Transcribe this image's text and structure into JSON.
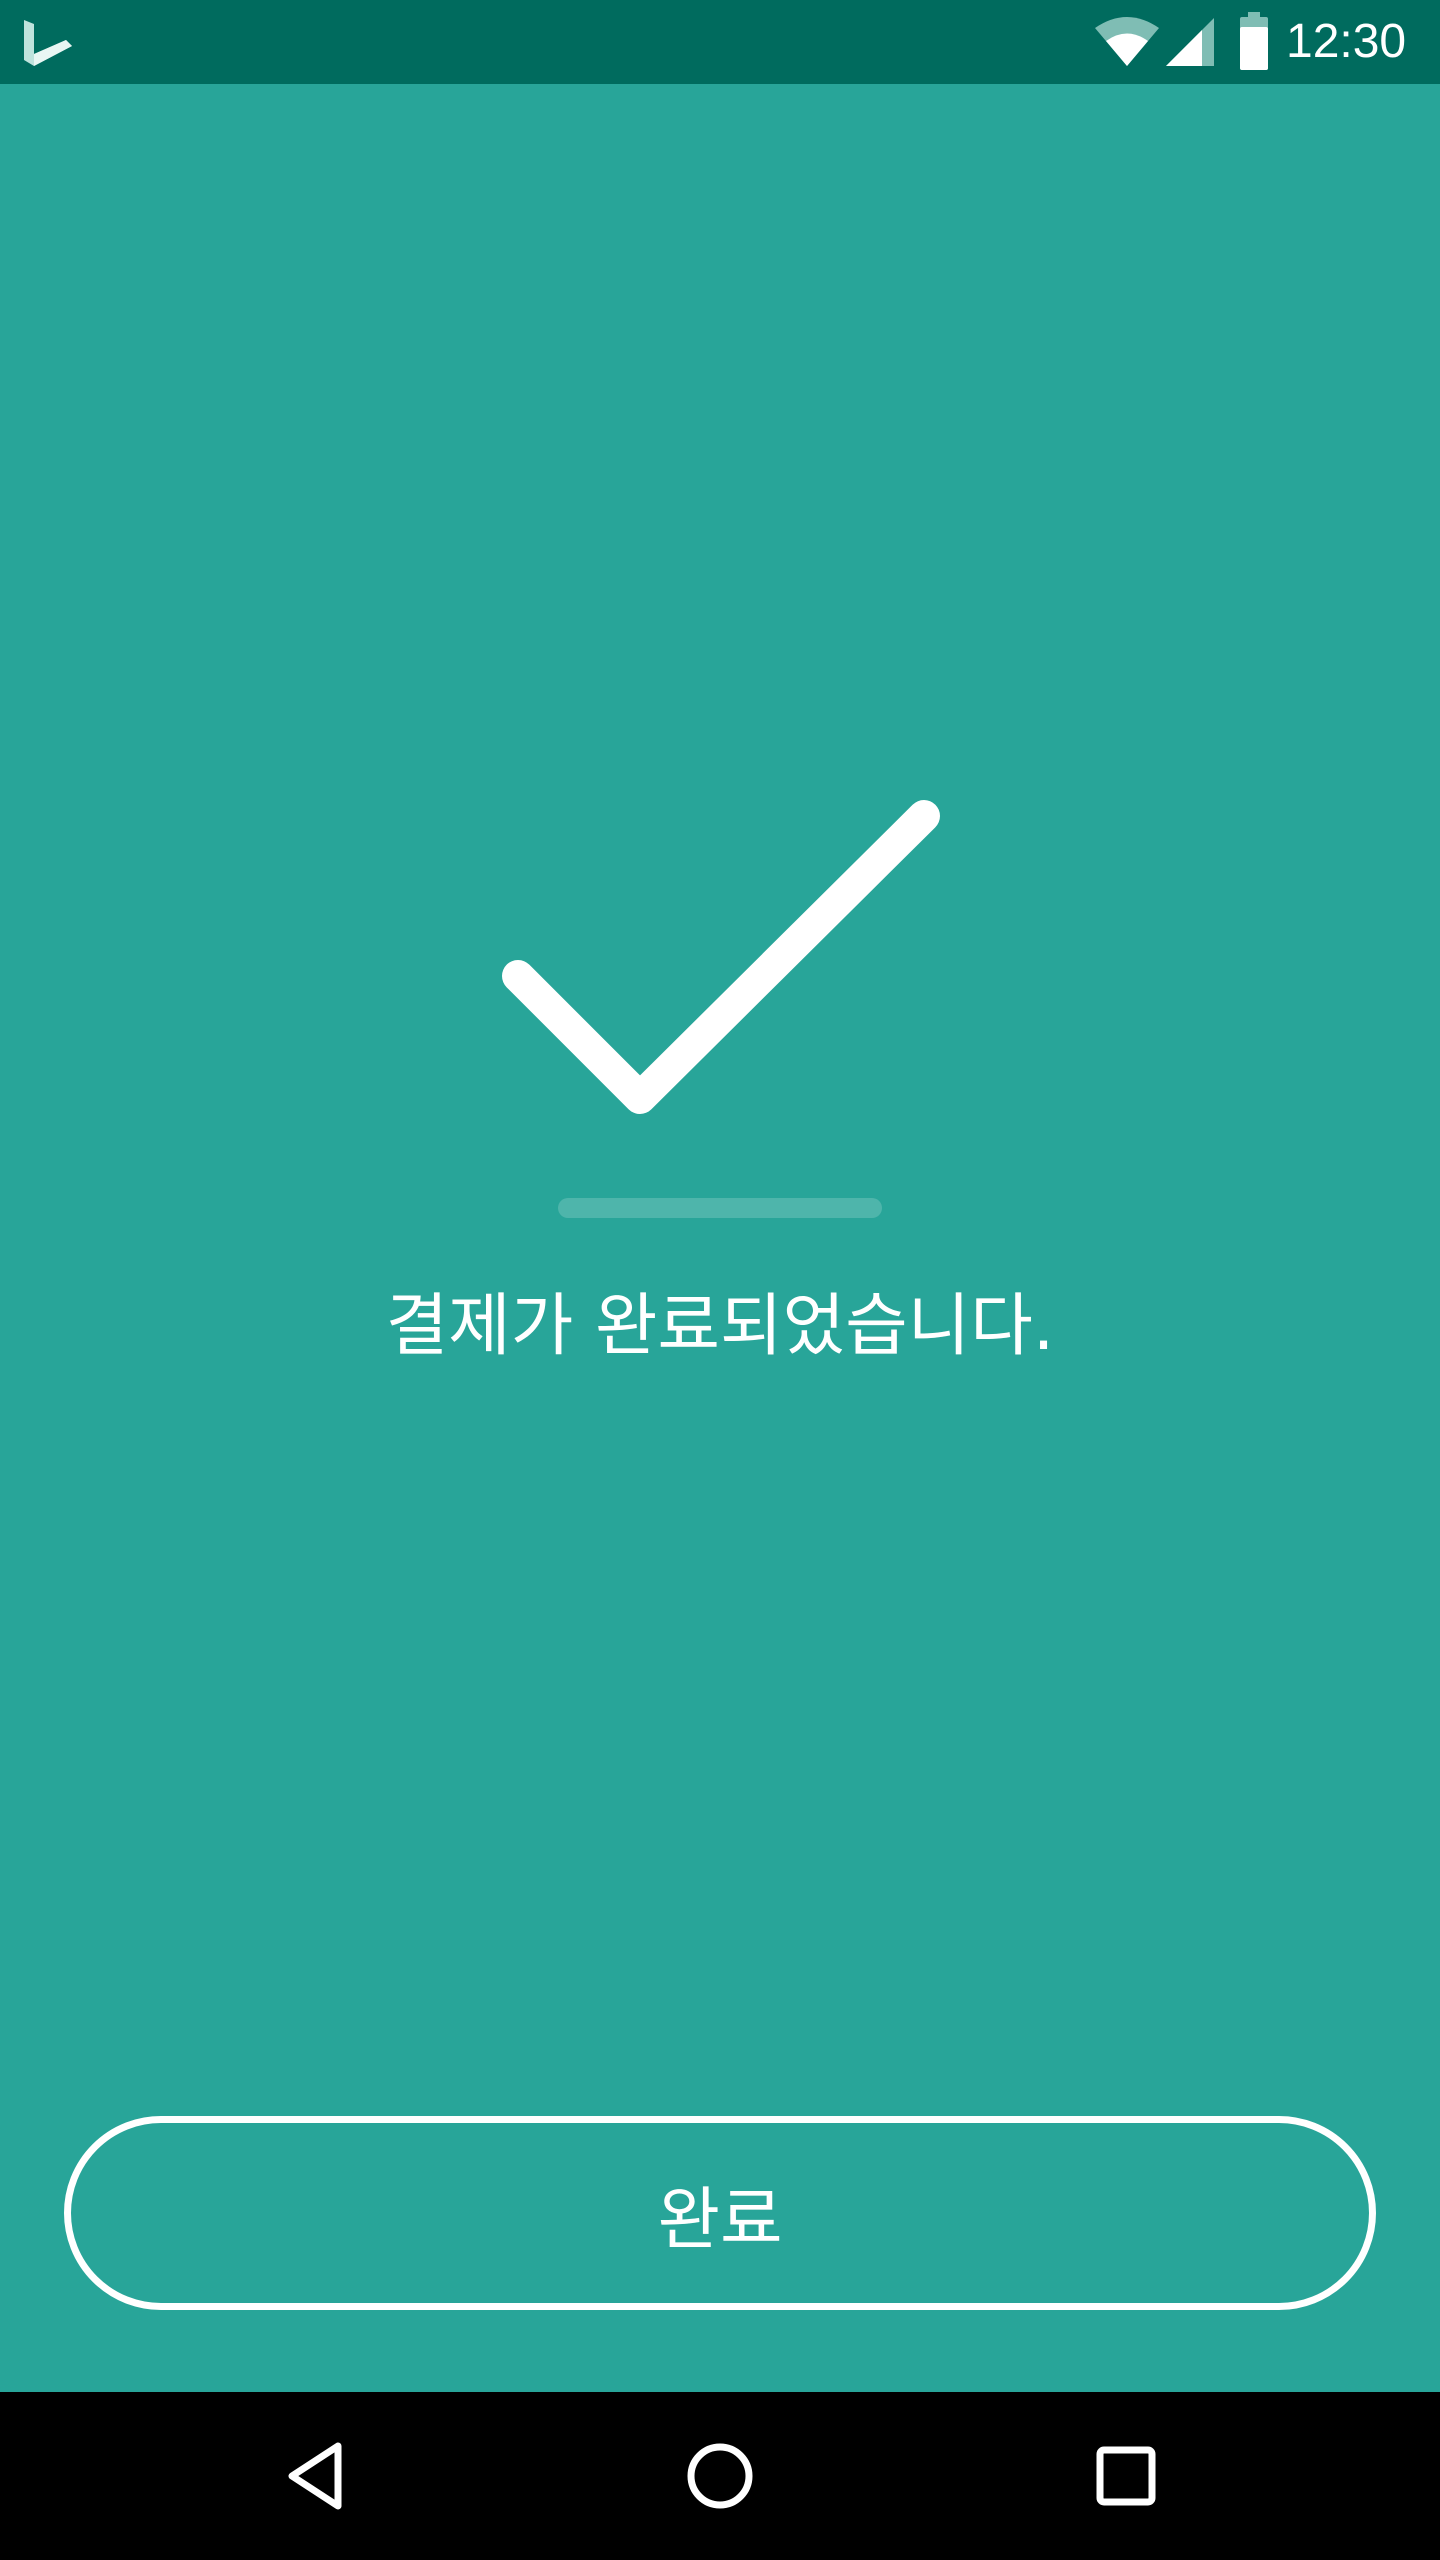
{
  "status_bar": {
    "time": "12:30",
    "icons": [
      "bing-logo-icon",
      "wifi-icon",
      "cell-signal-icon",
      "battery-icon"
    ]
  },
  "main": {
    "status_icon": "checkmark-icon",
    "message": "결제가 완료되었습니다.",
    "done_button_label": "완료"
  },
  "nav_bar": {
    "buttons": [
      "back-icon",
      "home-icon",
      "recents-icon"
    ]
  },
  "colors": {
    "background": "#28a599",
    "status_bar": "#006b5e",
    "foreground": "#ffffff",
    "nav_bar": "#000000"
  }
}
